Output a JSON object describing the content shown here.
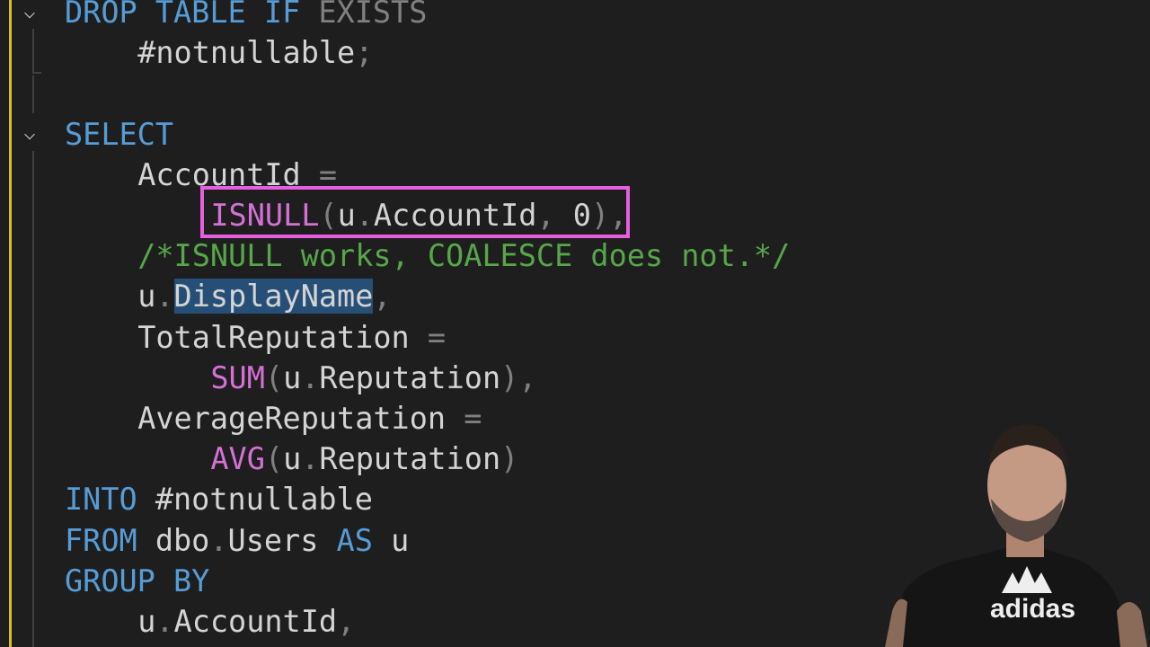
{
  "editor": {
    "lines": [
      {
        "indent": 0,
        "tokens": [
          [
            "kw",
            "DROP TABLE IF "
          ],
          [
            "pn",
            "EXISTS"
          ]
        ]
      },
      {
        "indent": 2,
        "tokens": [
          [
            "id",
            "#notnullable"
          ],
          [
            "pn",
            ";"
          ]
        ]
      },
      {
        "indent": 0,
        "tokens": []
      },
      {
        "indent": 0,
        "tokens": [
          [
            "kw",
            "SELECT"
          ]
        ]
      },
      {
        "indent": 2,
        "tokens": [
          [
            "id",
            "AccountId "
          ],
          [
            "pn",
            "="
          ]
        ]
      },
      {
        "indent": 4,
        "tokens": [
          [
            "fn",
            "ISNULL"
          ],
          [
            "pn",
            "("
          ],
          [
            "id",
            "u"
          ],
          [
            "pn",
            "."
          ],
          [
            "id",
            "AccountId"
          ],
          [
            "pn",
            ", "
          ],
          [
            "id",
            "0"
          ],
          [
            "pn",
            "),"
          ]
        ]
      },
      {
        "indent": 2,
        "tokens": [
          [
            "cm",
            "/*ISNULL works, COALESCE does not.*/"
          ]
        ]
      },
      {
        "indent": 2,
        "tokens": [
          [
            "id",
            "u"
          ],
          [
            "pn",
            "."
          ],
          [
            "sel",
            "DisplayName"
          ],
          [
            "pn",
            ","
          ]
        ]
      },
      {
        "indent": 2,
        "tokens": [
          [
            "id",
            "TotalReputation "
          ],
          [
            "pn",
            "="
          ]
        ]
      },
      {
        "indent": 4,
        "tokens": [
          [
            "fn",
            "SUM"
          ],
          [
            "pn",
            "("
          ],
          [
            "id",
            "u"
          ],
          [
            "pn",
            "."
          ],
          [
            "id",
            "Reputation"
          ],
          [
            "pn",
            "),"
          ]
        ]
      },
      {
        "indent": 2,
        "tokens": [
          [
            "id",
            "AverageReputation "
          ],
          [
            "pn",
            "="
          ]
        ]
      },
      {
        "indent": 4,
        "tokens": [
          [
            "fn",
            "AVG"
          ],
          [
            "pn",
            "("
          ],
          [
            "id",
            "u"
          ],
          [
            "pn",
            "."
          ],
          [
            "id",
            "Reputation"
          ],
          [
            "pn",
            ")"
          ]
        ]
      },
      {
        "indent": 0,
        "tokens": [
          [
            "kw",
            "INTO "
          ],
          [
            "id",
            "#notnullable"
          ]
        ]
      },
      {
        "indent": 0,
        "tokens": [
          [
            "kw",
            "FROM "
          ],
          [
            "id",
            "dbo"
          ],
          [
            "pn",
            "."
          ],
          [
            "id",
            "Users "
          ],
          [
            "kw",
            "AS "
          ],
          [
            "id",
            "u"
          ]
        ]
      },
      {
        "indent": 0,
        "tokens": [
          [
            "kw",
            "GROUP BY"
          ]
        ]
      },
      {
        "indent": 2,
        "tokens": [
          [
            "id",
            "u"
          ],
          [
            "pn",
            "."
          ],
          [
            "id",
            "AccountId"
          ],
          [
            "pn",
            ","
          ]
        ]
      }
    ]
  },
  "fold_icons": [
    "chevron-down-icon",
    "chevron-down-icon"
  ],
  "colors": {
    "keyword": "#569cd6",
    "function": "#d670d6",
    "comment": "#57a64a",
    "highlight_box": "#e85ee0",
    "selection": "#264f78",
    "gutter_marker": "#d4c12a"
  }
}
